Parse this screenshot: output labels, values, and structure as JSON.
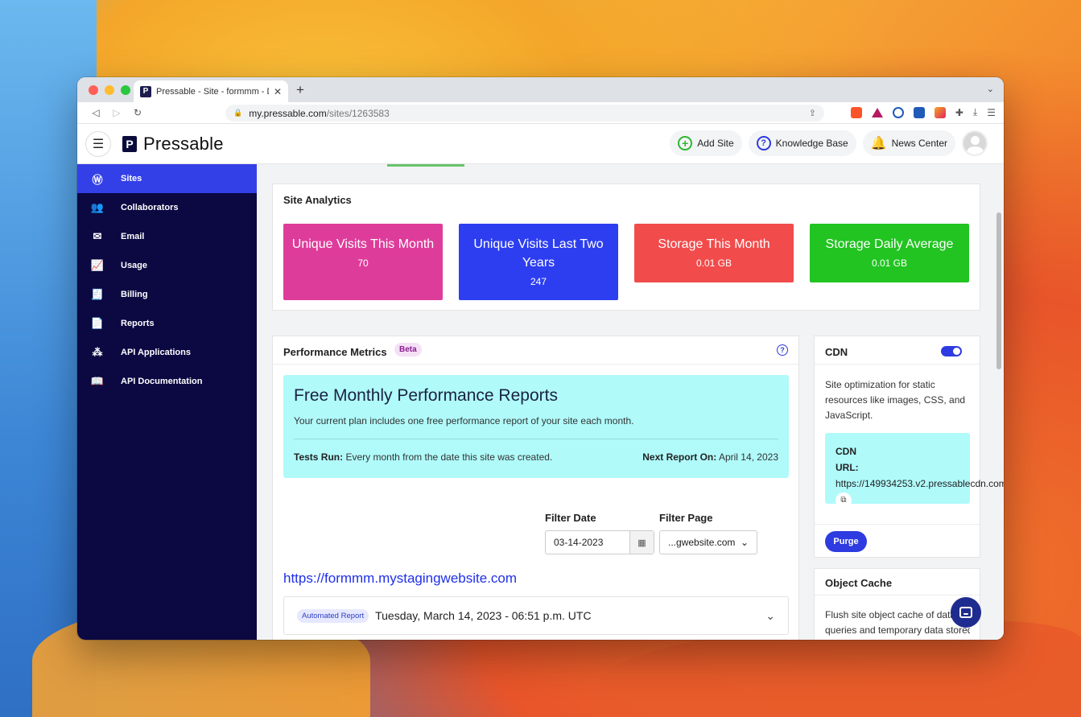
{
  "browser": {
    "tab_title": "Pressable - Site - formmm - Des",
    "tab_close": "✕",
    "new_tab": "+",
    "url_host": "my.pressable.com",
    "url_path": "/sites/1263583"
  },
  "header": {
    "logo_mark": "P",
    "logo_text": "Pressable",
    "add_site": "Add Site",
    "knowledge_base": "Knowledge Base",
    "news_center": "News Center"
  },
  "sidebar": {
    "items": [
      {
        "label": "Sites",
        "icon": "wordpress-icon"
      },
      {
        "label": "Collaborators",
        "icon": "users-icon"
      },
      {
        "label": "Email",
        "icon": "mail-icon"
      },
      {
        "label": "Usage",
        "icon": "chart-icon"
      },
      {
        "label": "Billing",
        "icon": "invoice-icon"
      },
      {
        "label": "Reports",
        "icon": "report-icon"
      },
      {
        "label": "API Applications",
        "icon": "network-icon"
      },
      {
        "label": "API Documentation",
        "icon": "book-icon"
      }
    ]
  },
  "analytics": {
    "title": "Site Analytics",
    "stats": [
      {
        "label": "Unique Visits This Month",
        "value": "70",
        "color": "#de3c9a"
      },
      {
        "label": "Unique Visits Last Two Years",
        "value": "247",
        "color": "#2d3ef0"
      },
      {
        "label": "Storage This Month",
        "value": "0.01 GB",
        "color": "#f24b4b"
      },
      {
        "label": "Storage Daily Average",
        "value": "0.01 GB",
        "color": "#21c421"
      }
    ]
  },
  "performance": {
    "title": "Performance Metrics",
    "badge": "Beta",
    "report_title": "Free Monthly Performance Reports",
    "report_sub": "Your current plan includes one free performance report of your site each month.",
    "tests_label": "Tests Run:",
    "tests_value": "Every month from the date this site was created.",
    "next_label": "Next Report On:",
    "next_value": "April 14, 2023",
    "filter_date_label": "Filter Date",
    "filter_date_value": "03-14-2023",
    "filter_page_label": "Filter Page",
    "filter_page_value": "...gwebsite.com",
    "site_link": "https://formmm.mystagingwebsite.com",
    "report_badge": "Automated Report",
    "report_date": "Tuesday, March 14, 2023 - 06:51 p.m. UTC"
  },
  "cdn": {
    "title": "CDN",
    "enabled": true,
    "description": "Site optimization for static resources like images, CSS, and JavaScript.",
    "url_heading": "CDN",
    "url_label": "URL:",
    "url_value": "https://149934253.v2.pressablecdn.com/",
    "purge": "Purge"
  },
  "object_cache": {
    "title": "Object Cache",
    "line1": "Flush site object cache of datab",
    "line2": "queries and temporary data stored"
  },
  "colors": {
    "sidebar_bg": "#0b0842",
    "accent": "#2d3be0",
    "report_bg": "#b0fafa"
  }
}
